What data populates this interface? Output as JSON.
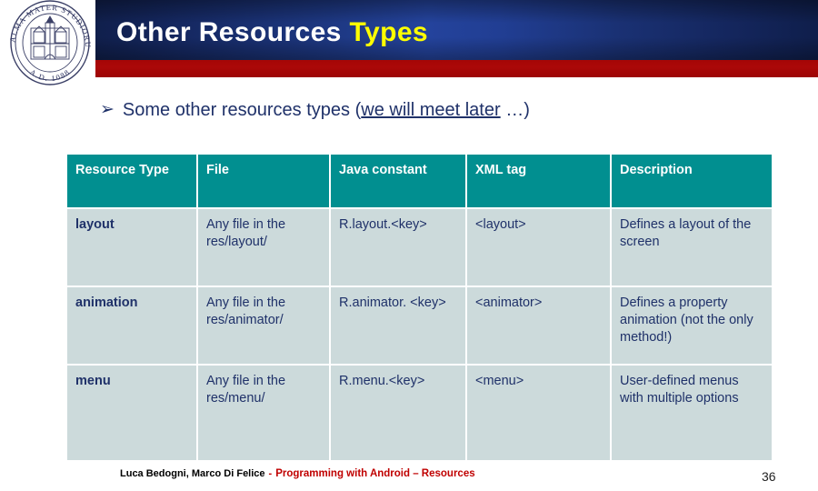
{
  "slide": {
    "title_main": "Other Resources",
    "title_accent": "Types",
    "bullet_glyph": "➢",
    "bullet_prefix": "Some other resources types (",
    "bullet_underlined": "we will meet later",
    "bullet_suffix": " …)",
    "page_number": "36"
  },
  "logo": {
    "outer_text": "ALMA MATER STUDIORUM",
    "year_text": "A.D. 1088",
    "name": "university-of-bologna-seal"
  },
  "table": {
    "headers": [
      "Resource Type",
      "File",
      "Java constant",
      "XML tag",
      "Description"
    ],
    "rows": [
      {
        "resource_type": "layout",
        "file": "Any file in the res/layout/",
        "java_constant": "R.layout.<key>",
        "xml_tag": "<layout>",
        "description": "Defines a layout of the screen"
      },
      {
        "resource_type": "animation",
        "file": "Any file in the res/animator/",
        "java_constant": "R.animator. <key>",
        "xml_tag": "<animator>",
        "description": "Defines a property animation (not the only method!)"
      },
      {
        "resource_type": "menu",
        "file": "Any file in the res/menu/",
        "java_constant": "R.menu.<key>",
        "xml_tag": "<menu>",
        "description": "User-defined menus with multiple options"
      }
    ]
  },
  "footer": {
    "authors": "Luca Bedogni, Marco Di Felice",
    "dash": "-",
    "subject": "Programming with Android – Resources"
  },
  "colors": {
    "banner_navy": "#13265d",
    "banner_blue": "#24439c",
    "red_bar": "#a50606",
    "title_accent": "#ffff00",
    "table_header": "#018f90",
    "table_cell": "#ccdadb",
    "text_blue": "#1f3169",
    "footer_red": "#c00000"
  }
}
